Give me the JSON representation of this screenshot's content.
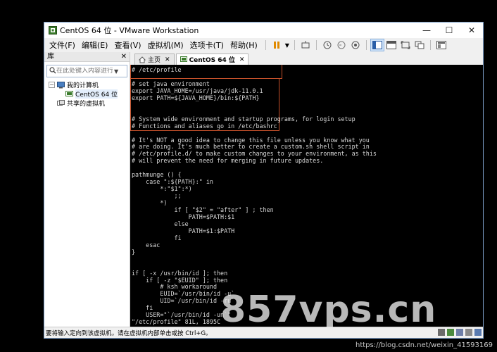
{
  "window": {
    "title": "CentOS 64 位 - VMware Workstation"
  },
  "menu": [
    "文件(F)",
    "编辑(E)",
    "查看(V)",
    "虚拟机(M)",
    "选项卡(T)",
    "帮助(H)"
  ],
  "library": {
    "title": "库",
    "search_placeholder": "在此处键入内容进行...",
    "tree": {
      "my_computer": "我的计算机",
      "vm": "CentOS 64 位",
      "shared": "共享的虚拟机"
    }
  },
  "tabs": {
    "home": "主页",
    "vm": "CentOS 64 位"
  },
  "terminal_lines": [
    "# /etc/profile",
    "",
    "# set java environment",
    "export JAVA_HOME=/usr/java/jdk-11.0.1",
    "export PATH=${JAVA_HOME}/bin:${PATH}",
    "",
    "",
    "# System wide environment and startup programs, for login setup",
    "# Functions and aliases go in /etc/bashrc",
    "",
    "# It's NOT a good idea to change this file unless you know what you",
    "# are doing. It's much better to create a custom.sh shell script in",
    "# /etc/profile.d/ to make custom changes to your environment, as this",
    "# will prevent the need for merging in future updates.",
    "",
    "pathmunge () {",
    "    case \":${PATH}:\" in",
    "        *:\"$1\":*)",
    "            ;;",
    "        *)",
    "            if [ \"$2\" = \"after\" ] ; then",
    "                PATH=$PATH:$1",
    "            else",
    "                PATH=$1:$PATH",
    "            fi",
    "    esac",
    "}",
    "",
    "",
    "if [ -x /usr/bin/id ]; then",
    "    if [ -z \"$EUID\" ]; then",
    "        # ksh workaround",
    "        EUID=`/usr/bin/id -u`",
    "        UID=`/usr/bin/id -ru`",
    "    fi",
    "    USER=\"`/usr/bin/id -un`\"",
    "\"/etc/profile\" 81L, 1895C"
  ],
  "status": {
    "text": "要将输入定向到该虚拟机，请在虚拟机内部单击或按 Ctrl+G。"
  },
  "watermark": "857vps.cn",
  "credit": "https://blog.csdn.net/weixin_41593169",
  "colors": {
    "highlight_box": "#c5502a",
    "terminal_bg": "#000000",
    "terminal_fg": "#d8d8d8"
  }
}
